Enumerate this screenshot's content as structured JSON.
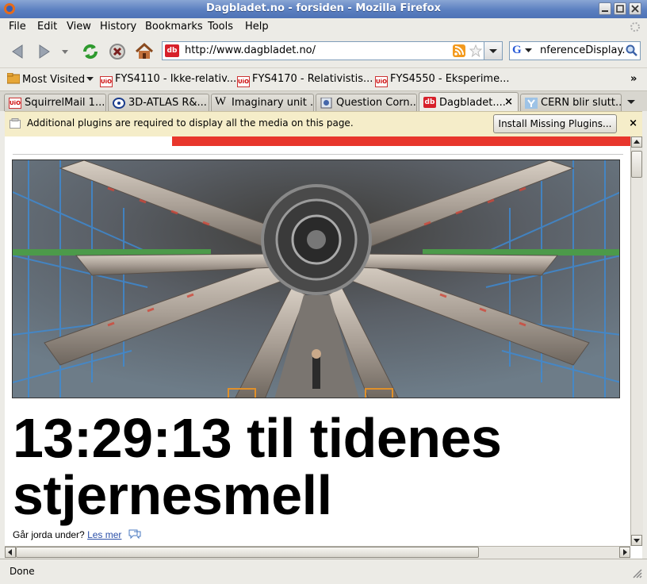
{
  "window": {
    "title": "Dagbladet.no - forsiden - Mozilla Firefox"
  },
  "menu": [
    "File",
    "Edit",
    "View",
    "History",
    "Bookmarks",
    "Tools",
    "Help"
  ],
  "urlbar": {
    "favicon": "db",
    "url": "http://www.dagbladet.no/"
  },
  "searchbar": {
    "engine": "G",
    "text": "nferenceDisplay.p"
  },
  "bookmarks": [
    {
      "label": "Most Visited",
      "icon": "folder-icon"
    },
    {
      "label": "FYS4110 - Ikke-relativ...",
      "icon": "UiO"
    },
    {
      "label": "FYS4170 - Relativistis...",
      "icon": "UiO"
    },
    {
      "label": "FYS4550 - Eksperime...",
      "icon": "UiO"
    }
  ],
  "bookmarks_overflow": "»",
  "tabs": [
    {
      "label": "SquirrelMail 1....",
      "icon": "UiO"
    },
    {
      "label": "3D-ATLAS R&...",
      "icon": "atlas"
    },
    {
      "label": "Imaginary unit ...",
      "icon": "W"
    },
    {
      "label": "Question Corn...",
      "icon": "q"
    },
    {
      "label": "Dagbladet....",
      "icon": "db",
      "close": "×"
    },
    {
      "label": "CERN blir slutt...",
      "icon": "cern"
    }
  ],
  "notification": {
    "message": "Additional plugins are required to display all the media on this page.",
    "button": "Install Missing Plugins...",
    "close": "×"
  },
  "article": {
    "headline_line1": "13:29:13  til tidenes",
    "headline_line2": "stjernesmell",
    "subline": "Går jorda under?",
    "link": "Les mer"
  },
  "status": {
    "text": "Done"
  },
  "colors": {
    "titlebar": "#5b7fc0",
    "accent_red": "#e8362c",
    "link": "#2a4fa8"
  }
}
